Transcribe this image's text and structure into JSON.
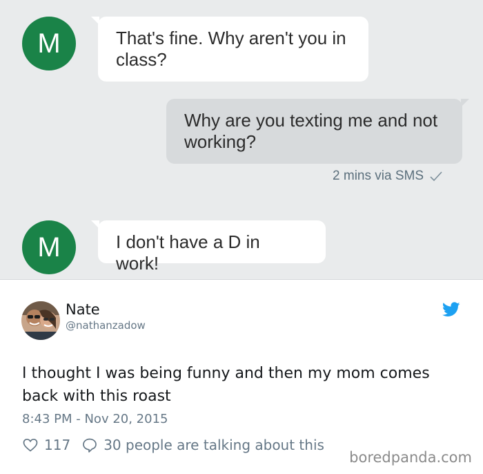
{
  "conversation": {
    "sender_initial": "M",
    "messages": [
      {
        "direction": "incoming",
        "text": "That's fine. Why aren't you in class?"
      },
      {
        "direction": "outgoing",
        "text": "Why are you texting me and not working?"
      },
      {
        "direction": "incoming",
        "text": "I don't have a D in work!"
      }
    ],
    "outgoing_meta": "2 mins via SMS",
    "outgoing_meta_icon": "checkmark-icon",
    "colors": {
      "avatar": "#1a8348",
      "background": "#e9ebec",
      "outgoing_bubble": "#d7dadc"
    }
  },
  "tweet": {
    "name": "Nate",
    "handle": "@nathanzadow",
    "text": "I thought I was being funny and then my mom comes back with this roast",
    "timestamp": "8:43 PM - Nov 20, 2015",
    "likes": "117",
    "talking": "30 people are talking about this",
    "brand_icon": "twitter-bird-icon",
    "colors": {
      "brand": "#1da1f2"
    }
  },
  "watermark": "boredpanda.com"
}
